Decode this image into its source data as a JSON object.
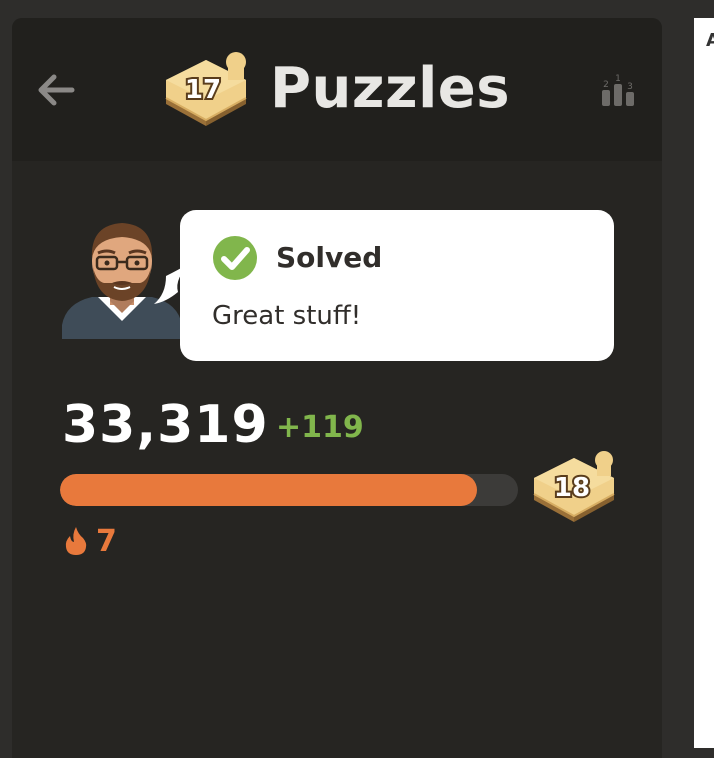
{
  "header": {
    "title": "Puzzles",
    "level_badge": "17",
    "back_icon": "arrow-left-icon",
    "leaderboard_icon": "leaderboard-podium-icon"
  },
  "result": {
    "status": "Solved",
    "message": "Great stuff!",
    "status_icon": "check-circle-icon"
  },
  "rating": {
    "value": "33,319",
    "delta": "+119",
    "progress_percent": 91,
    "next_level": "18"
  },
  "streak": {
    "icon": "flame-icon",
    "count": "7"
  },
  "right_pane": {
    "text": "A"
  },
  "colors": {
    "background": "#262522",
    "header": "#21201d",
    "accent_orange": "#e8793c",
    "success_green": "#81b64c"
  }
}
